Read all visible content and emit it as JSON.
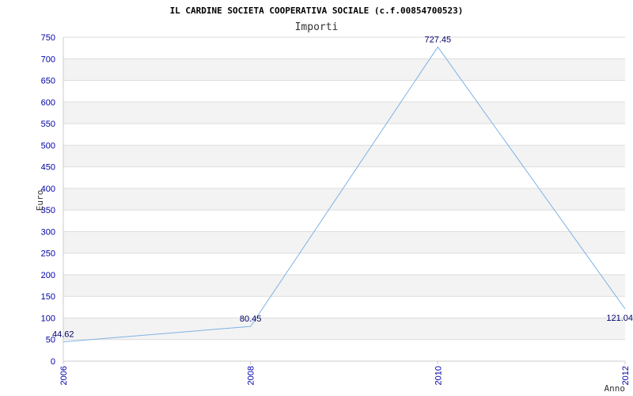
{
  "chart_data": {
    "type": "line",
    "title": "IL CARDINE SOCIETA COOPERATIVA SOCIALE (c.f.00854700523)",
    "subtitle": "Importi",
    "xlabel": "Anno",
    "ylabel": "Euro",
    "x": [
      "2006",
      "2008",
      "2010",
      "2012"
    ],
    "series": [
      {
        "values": [
          44.62,
          80.45,
          727.45,
          121.04
        ],
        "labels": [
          "44.62",
          "80.45",
          "727.45",
          "121.04"
        ]
      }
    ],
    "ylim": [
      0,
      750
    ],
    "yticks": [
      "0",
      "50",
      "100",
      "150",
      "200",
      "250",
      "300",
      "350",
      "400",
      "450",
      "500",
      "550",
      "600",
      "650",
      "700",
      "750"
    ],
    "grid": "horizontal alternating bands",
    "colors": {
      "line": "#7fb2e5",
      "tick": "#0000aa",
      "band": "#f3f3f3",
      "gridline": "#dddddd",
      "axis": "#cccccc"
    }
  }
}
